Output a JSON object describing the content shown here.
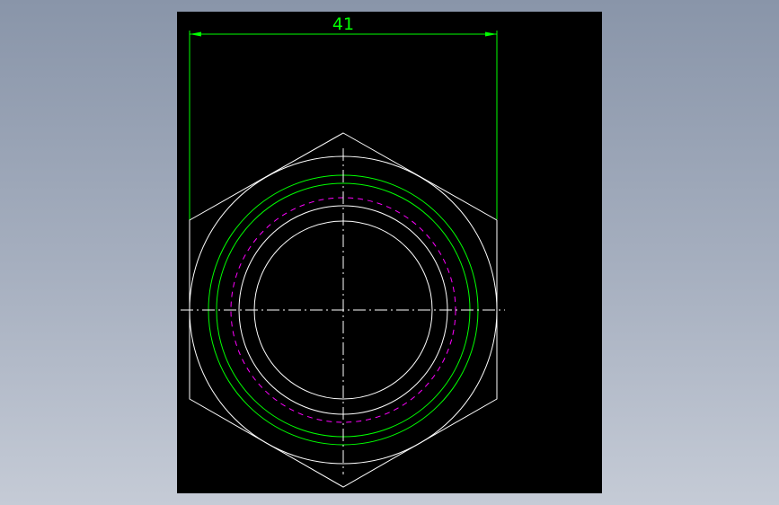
{
  "drawing": {
    "dimension": {
      "value_text": "41"
    },
    "colors": {
      "background": "#000000",
      "outline": "#ffffff",
      "dimension": "#00ff00",
      "thread": "#00ff00",
      "hidden_thread": "#ff00ff",
      "centerline": "#ffffff"
    }
  }
}
